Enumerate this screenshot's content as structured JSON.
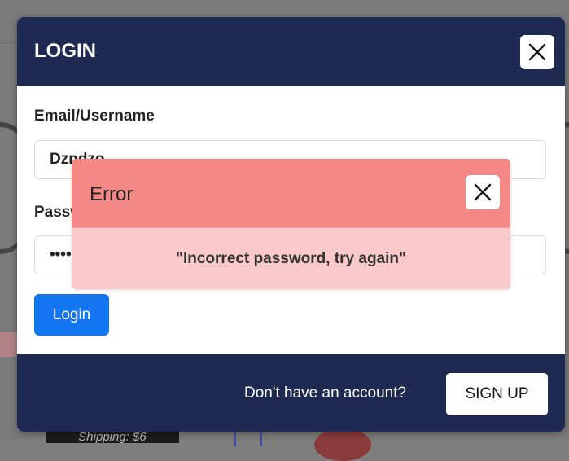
{
  "modal": {
    "title": "LOGIN",
    "email_label": "Email/Username",
    "email_value": "Dzndzo",
    "password_label": "Password",
    "password_value": "••••",
    "login_label": "Login",
    "footer_prompt": "Don't have an account?",
    "signup_label": "SIGN UP"
  },
  "error": {
    "title": "Error",
    "message": "\"Incorrect password, try again\""
  },
  "background": {
    "shipping_text": "Shipping: $6"
  },
  "colors": {
    "header_bg": "#1f2a52",
    "login_button": "#1475f0",
    "error_header": "#f38886",
    "error_body": "#f9c9c9"
  },
  "icons": {
    "close": "close-icon"
  }
}
